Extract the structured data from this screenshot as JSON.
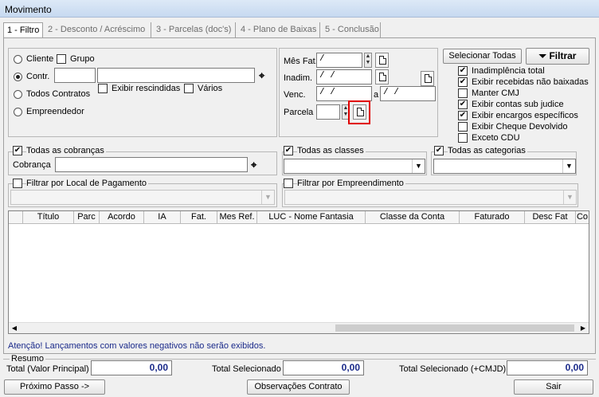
{
  "window": {
    "title": "Movimento"
  },
  "tabs": [
    {
      "label": "1 - Filtro"
    },
    {
      "label": "2 - Desconto / Acréscimo"
    },
    {
      "label": "3 - Parcelas (doc's)"
    },
    {
      "label": "4 - Plano de Baixas"
    },
    {
      "label": "5 - Conclusão"
    }
  ],
  "party": {
    "cliente": "Cliente",
    "grupo": "Grupo",
    "contr": "Contr.",
    "todos_contratos": "Todos Contratos",
    "exibir_rescindidas": "Exibir rescindidas",
    "varios": "Vários",
    "empreendedor": "Empreendedor",
    "selected": "Contr."
  },
  "dates": {
    "mes_fat_label": "Mês Fat.",
    "mes_fat_value": "/",
    "inadim_label": "Inadim.",
    "inadim_value": "/ /",
    "venc_label": "Venc.",
    "venc_from": "/ /",
    "venc_sep": "a",
    "venc_to": "/ /",
    "parcela_label": "Parcela",
    "parcela_value": ""
  },
  "options": {
    "selecionar_todas": "Selecionar Todas",
    "filtrar": "Filtrar",
    "items": [
      {
        "label": "Inadimplência total",
        "checked": true
      },
      {
        "label": "Exibir recebidas não baixadas",
        "checked": true
      },
      {
        "label": "Manter CMJ",
        "checked": false
      },
      {
        "label": "Exibir contas sub judice",
        "checked": true
      },
      {
        "label": "Exibir encargos específicos",
        "checked": true
      },
      {
        "label": "Exibir Cheque Devolvido",
        "checked": false
      },
      {
        "label": "Exceto CDU",
        "checked": false
      }
    ]
  },
  "filters": {
    "todas_cobrancas": "Todas as cobranças",
    "cobranca_label": "Cobrança",
    "todas_classes": "Todas as classes",
    "todas_categorias": "Todas as categorias",
    "filtrar_local": "Filtrar por Local de Pagamento",
    "filtrar_empreendimento": "Filtrar por Empreendimento"
  },
  "grid": {
    "columns": [
      "Título",
      "Parc",
      "Acordo",
      "IA",
      "Fat.",
      "Mes Ref.",
      "LUC - Nome Fantasia",
      "Classe da Conta",
      "Faturado",
      "Desc Fat",
      "Co"
    ]
  },
  "warning": "Atenção! Lançamentos com valores negativos não serão exibidos.",
  "summary": {
    "title": "Resumo",
    "total_principal_label": "Total (Valor Principal)",
    "total_principal": "0,00",
    "total_sel_label": "Total Selecionado",
    "total_sel": "0,00",
    "total_sel_cmjd_label": "Total Selecionado (+CMJD)",
    "total_sel_cmjd": "0,00"
  },
  "buttons": {
    "proximo": "Próximo Passo ->",
    "observacoes": "Observações Contrato",
    "sair": "Sair"
  },
  "icons": [
    "binoculars-icon",
    "document-icon",
    "funnel-icon",
    "spin-arrows-icon",
    "checkmark-icon"
  ]
}
